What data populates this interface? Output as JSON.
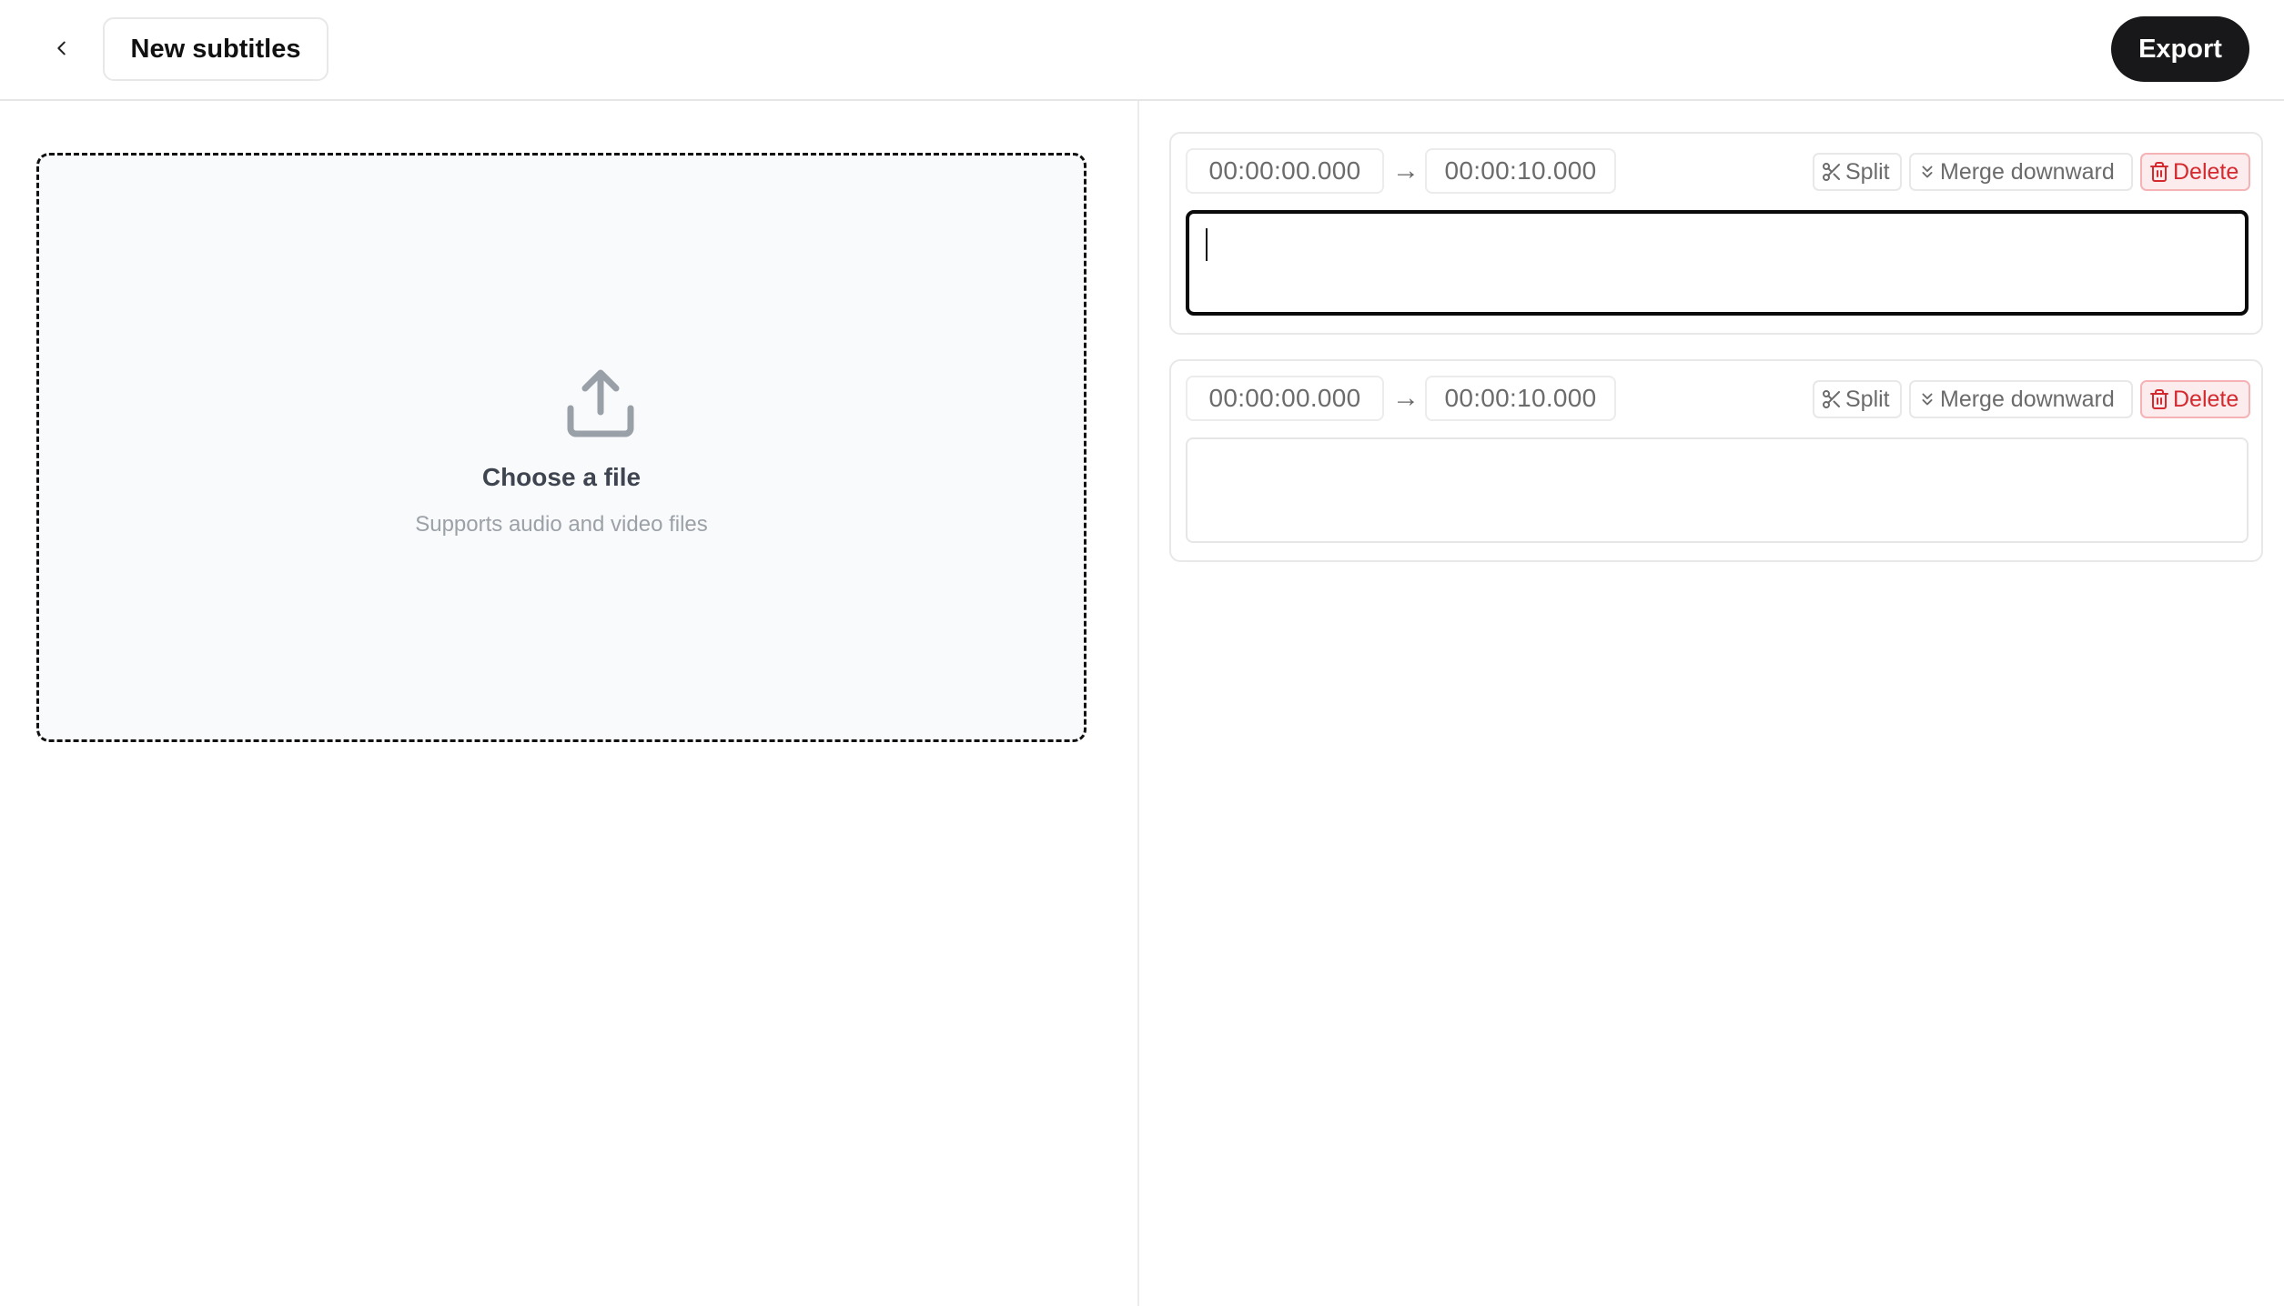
{
  "header": {
    "back_icon": "chevron-left-icon",
    "title": "New subtitles",
    "export_label": "Export"
  },
  "upload": {
    "icon": "upload-icon",
    "title": "Choose a file",
    "subtitle": "Supports audio and video files"
  },
  "cues": [
    {
      "start": "00:00:00.000",
      "arrow": "→",
      "end": "00:00:10.000",
      "split_label": "Split",
      "merge_label": "Merge downward",
      "delete_label": "Delete",
      "text": "",
      "focused": true
    },
    {
      "start": "00:00:00.000",
      "arrow": "→",
      "end": "00:00:10.000",
      "split_label": "Split",
      "merge_label": "Merge downward",
      "delete_label": "Delete",
      "text": "",
      "focused": false
    }
  ],
  "colors": {
    "primary": "#18181b",
    "danger": "#d42a2f",
    "danger_bg": "#fdeced",
    "muted_text": "#6b6b6b",
    "dropzone_bg": "#f9fafb"
  }
}
